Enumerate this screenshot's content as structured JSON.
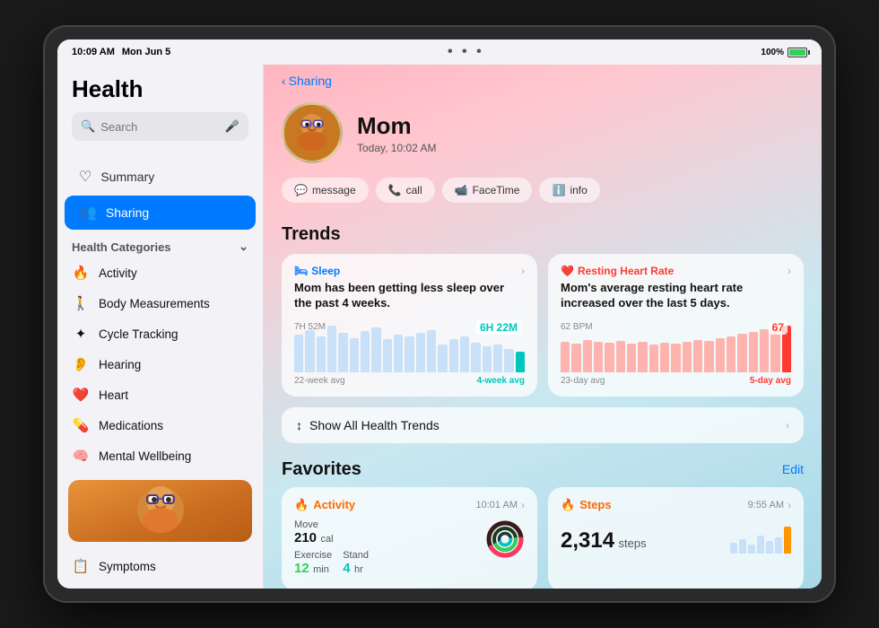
{
  "device": {
    "time": "10:09 AM",
    "date": "Mon Jun 5",
    "battery": "100%",
    "wifi": true,
    "dots": "• • •"
  },
  "sidebar": {
    "title": "Health",
    "search_placeholder": "Search",
    "nav_items": [
      {
        "label": "Summary",
        "icon": "♡",
        "active": false
      },
      {
        "label": "Sharing",
        "icon": "👥",
        "active": true
      }
    ],
    "categories_header": "Health Categories",
    "categories": [
      {
        "label": "Activity",
        "icon": "🔥"
      },
      {
        "label": "Body Measurements",
        "icon": "🚶"
      },
      {
        "label": "Cycle Tracking",
        "icon": "✦"
      },
      {
        "label": "Hearing",
        "icon": "👂"
      },
      {
        "label": "Heart",
        "icon": "❤️"
      },
      {
        "label": "Medications",
        "icon": "💊"
      },
      {
        "label": "Mental Wellbeing",
        "icon": "🧠"
      }
    ],
    "symptoms_label": "Symptoms"
  },
  "main": {
    "back_label": "Sharing",
    "profile": {
      "name": "Mom",
      "time": "Today, 10:02 AM",
      "avatar_emoji": "👩"
    },
    "actions": [
      {
        "label": "message",
        "icon": "💬"
      },
      {
        "label": "call",
        "icon": "📞"
      },
      {
        "label": "FaceTime",
        "icon": "📹"
      },
      {
        "label": "info",
        "icon": "ℹ️"
      }
    ],
    "trends_title": "Trends",
    "trend_cards": [
      {
        "label": "Sleep",
        "label_color": "blue",
        "icon": "🛏",
        "description": "Mom has been getting less sleep over the past 4 weeks.",
        "y_label": "7H 52M",
        "highlight_val": "6H 22M",
        "left_label": "22-week avg",
        "right_label": "4-week avg",
        "bars": [
          40,
          45,
          38,
          50,
          42,
          36,
          44,
          48,
          35,
          40,
          38,
          42,
          45,
          30,
          35,
          38,
          32,
          28,
          30,
          25,
          22
        ],
        "highlight_index": 20
      },
      {
        "label": "Resting Heart Rate",
        "label_color": "red",
        "icon": "❤️",
        "description": "Mom's average resting heart rate increased over the last 5 days.",
        "y_label": "62 BPM",
        "highlight_val": "67",
        "left_label": "23-day avg",
        "right_label": "5-day avg",
        "bars": [
          30,
          28,
          32,
          30,
          29,
          31,
          28,
          30,
          27,
          29,
          28,
          30,
          32,
          31,
          33,
          35,
          38,
          40,
          42,
          44,
          46
        ],
        "highlight_index": 20
      }
    ],
    "show_all_trends": "Show All Health Trends",
    "favorites_title": "Favorites",
    "edit_label": "Edit",
    "fav_cards": [
      {
        "label": "Activity",
        "icon": "🔥",
        "time": "10:01 AM",
        "stats": [
          {
            "label": "Move",
            "value": "210",
            "unit": "cal"
          },
          {
            "label": "Exercise",
            "value": "12",
            "unit": "min"
          },
          {
            "label": "Stand",
            "value": "4",
            "unit": "hr"
          }
        ],
        "has_ring": true
      },
      {
        "label": "Steps",
        "icon": "🔥",
        "time": "9:55 AM",
        "steps_value": "2,314",
        "steps_unit": "steps",
        "has_bars": true
      }
    ]
  }
}
